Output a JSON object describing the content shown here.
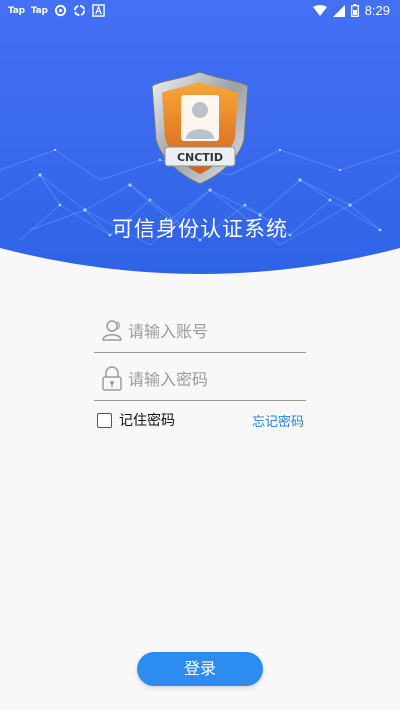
{
  "status_bar": {
    "app_icon_1": "Tap",
    "app_icon_2": "Tap",
    "time": "8:29"
  },
  "header": {
    "app_title": "可信身份认证系统",
    "badge_text": "CNCTID"
  },
  "form": {
    "username_placeholder": "请输入账号",
    "password_placeholder": "请输入密码",
    "remember_label": "记住密码",
    "forgot_label": "忘记密码"
  },
  "login_button": "登录",
  "colors": {
    "header_blue": "#3f6ff0",
    "link_blue": "#2a7de0",
    "button_blue": "#2c8cf0",
    "shield_orange": "#e07a1a"
  }
}
